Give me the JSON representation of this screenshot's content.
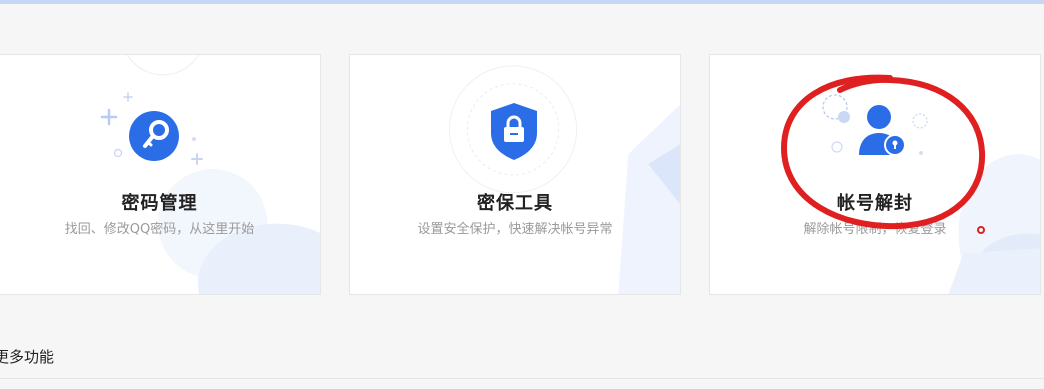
{
  "cards": [
    {
      "title": "密码管理",
      "description": "找回、修改QQ密码，从这里开始",
      "icon": "key-icon"
    },
    {
      "title": "密保工具",
      "description": "设置安全保护，快速解决帐号异常",
      "icon": "shield-lock-icon"
    },
    {
      "title": "帐号解封",
      "description": "解除帐号限制，恢复登录",
      "icon": "user-lock-icon"
    }
  ],
  "section": {
    "title": "更多功能"
  },
  "colors": {
    "accent": "#2b6de6",
    "annotation": "#e02020"
  }
}
